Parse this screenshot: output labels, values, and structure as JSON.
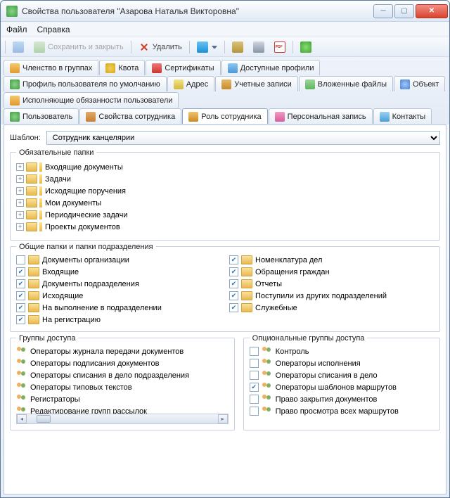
{
  "window": {
    "title": "Свойства пользователя \"Азарова Наталья Викторовна\""
  },
  "menu": {
    "file": "Файл",
    "help": "Справка"
  },
  "toolbar": {
    "save_close": "Сохранить и закрыть",
    "delete": "Удалить"
  },
  "tabs": {
    "r1": [
      "Членство в группах",
      "Квота",
      "Сертификаты",
      "Доступные профили"
    ],
    "r2": [
      "Профиль пользователя по умолчанию",
      "Адрес",
      "Учетные записи",
      "Вложенные файлы",
      "Объект"
    ],
    "r3": [
      "Исполняющие обязанности пользователи"
    ],
    "r4": [
      "Пользователь",
      "Свойства сотрудника",
      "Роль сотрудника",
      "Персональная запись",
      "Контакты"
    ]
  },
  "template": {
    "label": "Шаблон:",
    "value": "Сотрудник канцелярии"
  },
  "mandatory": {
    "legend": "Обязательные папки",
    "items": [
      "Входящие документы",
      "Задачи",
      "Исходящие поручения",
      "Мои документы",
      "Периодические задачи",
      "Проекты документов"
    ]
  },
  "shared": {
    "legend": "Общие папки и папки подразделения",
    "left": [
      {
        "label": "Документы организации",
        "checked": false
      },
      {
        "label": "Входящие",
        "checked": true
      },
      {
        "label": "Документы подразделения",
        "checked": true
      },
      {
        "label": "Исходящие",
        "checked": true
      },
      {
        "label": "На выполнение в подразделении",
        "checked": true
      },
      {
        "label": "На регистрацию",
        "checked": true
      }
    ],
    "right": [
      {
        "label": "Номенклатура дел",
        "checked": true
      },
      {
        "label": "Обращения граждан",
        "checked": true
      },
      {
        "label": "Отчеты",
        "checked": true
      },
      {
        "label": "Поступили из других подразделений",
        "checked": true
      },
      {
        "label": "Служебные",
        "checked": true
      }
    ]
  },
  "access": {
    "legend": "Группы доступа",
    "items": [
      "Операторы журнала передачи документов",
      "Операторы подписания документов",
      "Операторы списания в дело подразделения",
      "Операторы типовых текстов",
      "Регистраторы",
      "Редактирование групп рассылок"
    ]
  },
  "optional": {
    "legend": "Опциональные группы доступа",
    "items": [
      {
        "label": "Контроль",
        "checked": false
      },
      {
        "label": "Операторы исполнения",
        "checked": false
      },
      {
        "label": "Операторы списания в дело",
        "checked": false
      },
      {
        "label": "Операторы шаблонов маршрутов",
        "checked": true
      },
      {
        "label": "Право закрытия документов",
        "checked": false
      },
      {
        "label": "Право просмотра всех маршрутов",
        "checked": false
      }
    ]
  }
}
